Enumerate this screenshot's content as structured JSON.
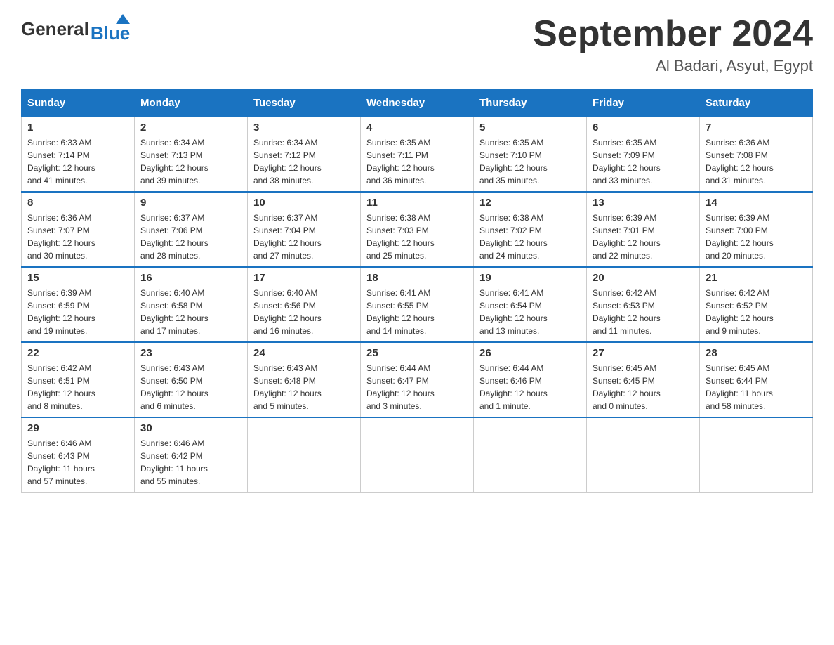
{
  "logo": {
    "general": "General",
    "blue": "Blue"
  },
  "title": "September 2024",
  "location": "Al Badari, Asyut, Egypt",
  "days_of_week": [
    "Sunday",
    "Monday",
    "Tuesday",
    "Wednesday",
    "Thursday",
    "Friday",
    "Saturday"
  ],
  "weeks": [
    [
      {
        "day": "1",
        "sunrise": "6:33 AM",
        "sunset": "7:14 PM",
        "daylight": "12 hours and 41 minutes."
      },
      {
        "day": "2",
        "sunrise": "6:34 AM",
        "sunset": "7:13 PM",
        "daylight": "12 hours and 39 minutes."
      },
      {
        "day": "3",
        "sunrise": "6:34 AM",
        "sunset": "7:12 PM",
        "daylight": "12 hours and 38 minutes."
      },
      {
        "day": "4",
        "sunrise": "6:35 AM",
        "sunset": "7:11 PM",
        "daylight": "12 hours and 36 minutes."
      },
      {
        "day": "5",
        "sunrise": "6:35 AM",
        "sunset": "7:10 PM",
        "daylight": "12 hours and 35 minutes."
      },
      {
        "day": "6",
        "sunrise": "6:35 AM",
        "sunset": "7:09 PM",
        "daylight": "12 hours and 33 minutes."
      },
      {
        "day": "7",
        "sunrise": "6:36 AM",
        "sunset": "7:08 PM",
        "daylight": "12 hours and 31 minutes."
      }
    ],
    [
      {
        "day": "8",
        "sunrise": "6:36 AM",
        "sunset": "7:07 PM",
        "daylight": "12 hours and 30 minutes."
      },
      {
        "day": "9",
        "sunrise": "6:37 AM",
        "sunset": "7:06 PM",
        "daylight": "12 hours and 28 minutes."
      },
      {
        "day": "10",
        "sunrise": "6:37 AM",
        "sunset": "7:04 PM",
        "daylight": "12 hours and 27 minutes."
      },
      {
        "day": "11",
        "sunrise": "6:38 AM",
        "sunset": "7:03 PM",
        "daylight": "12 hours and 25 minutes."
      },
      {
        "day": "12",
        "sunrise": "6:38 AM",
        "sunset": "7:02 PM",
        "daylight": "12 hours and 24 minutes."
      },
      {
        "day": "13",
        "sunrise": "6:39 AM",
        "sunset": "7:01 PM",
        "daylight": "12 hours and 22 minutes."
      },
      {
        "day": "14",
        "sunrise": "6:39 AM",
        "sunset": "7:00 PM",
        "daylight": "12 hours and 20 minutes."
      }
    ],
    [
      {
        "day": "15",
        "sunrise": "6:39 AM",
        "sunset": "6:59 PM",
        "daylight": "12 hours and 19 minutes."
      },
      {
        "day": "16",
        "sunrise": "6:40 AM",
        "sunset": "6:58 PM",
        "daylight": "12 hours and 17 minutes."
      },
      {
        "day": "17",
        "sunrise": "6:40 AM",
        "sunset": "6:56 PM",
        "daylight": "12 hours and 16 minutes."
      },
      {
        "day": "18",
        "sunrise": "6:41 AM",
        "sunset": "6:55 PM",
        "daylight": "12 hours and 14 minutes."
      },
      {
        "day": "19",
        "sunrise": "6:41 AM",
        "sunset": "6:54 PM",
        "daylight": "12 hours and 13 minutes."
      },
      {
        "day": "20",
        "sunrise": "6:42 AM",
        "sunset": "6:53 PM",
        "daylight": "12 hours and 11 minutes."
      },
      {
        "day": "21",
        "sunrise": "6:42 AM",
        "sunset": "6:52 PM",
        "daylight": "12 hours and 9 minutes."
      }
    ],
    [
      {
        "day": "22",
        "sunrise": "6:42 AM",
        "sunset": "6:51 PM",
        "daylight": "12 hours and 8 minutes."
      },
      {
        "day": "23",
        "sunrise": "6:43 AM",
        "sunset": "6:50 PM",
        "daylight": "12 hours and 6 minutes."
      },
      {
        "day": "24",
        "sunrise": "6:43 AM",
        "sunset": "6:48 PM",
        "daylight": "12 hours and 5 minutes."
      },
      {
        "day": "25",
        "sunrise": "6:44 AM",
        "sunset": "6:47 PM",
        "daylight": "12 hours and 3 minutes."
      },
      {
        "day": "26",
        "sunrise": "6:44 AM",
        "sunset": "6:46 PM",
        "daylight": "12 hours and 1 minute."
      },
      {
        "day": "27",
        "sunrise": "6:45 AM",
        "sunset": "6:45 PM",
        "daylight": "12 hours and 0 minutes."
      },
      {
        "day": "28",
        "sunrise": "6:45 AM",
        "sunset": "6:44 PM",
        "daylight": "11 hours and 58 minutes."
      }
    ],
    [
      {
        "day": "29",
        "sunrise": "6:46 AM",
        "sunset": "6:43 PM",
        "daylight": "11 hours and 57 minutes."
      },
      {
        "day": "30",
        "sunrise": "6:46 AM",
        "sunset": "6:42 PM",
        "daylight": "11 hours and 55 minutes."
      },
      null,
      null,
      null,
      null,
      null
    ]
  ]
}
